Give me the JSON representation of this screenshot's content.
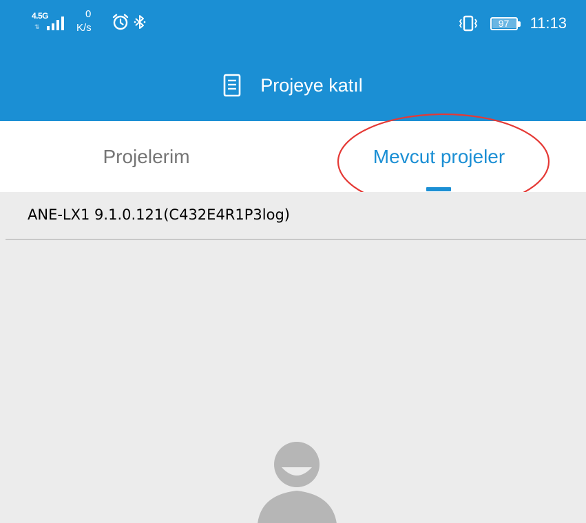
{
  "status_bar": {
    "network_type": "4.5G",
    "network_arrows": "⇅",
    "speed_value": "0",
    "speed_unit": "K/s",
    "icons": [
      "signal-icon",
      "alarm-icon",
      "bluetooth-icon",
      "vibrate-icon",
      "battery-icon"
    ],
    "battery_level": "97",
    "time": "11:13"
  },
  "app_bar": {
    "icon": "document-icon",
    "title": "Projeye katıl"
  },
  "tabs": [
    {
      "label": "Projelerim",
      "selected": false
    },
    {
      "label": "Mevcut projeler",
      "selected": true
    }
  ],
  "projects": [
    {
      "name": "ANE-LX1 9.1.0.121(C432E4R1P3log)"
    }
  ],
  "empty_state": {
    "icon": "user-avatar-icon"
  },
  "colors": {
    "primary": "#1b8fd4",
    "tab_inactive": "#757575",
    "content_bg": "#ececec",
    "annotation": "#e53935"
  }
}
